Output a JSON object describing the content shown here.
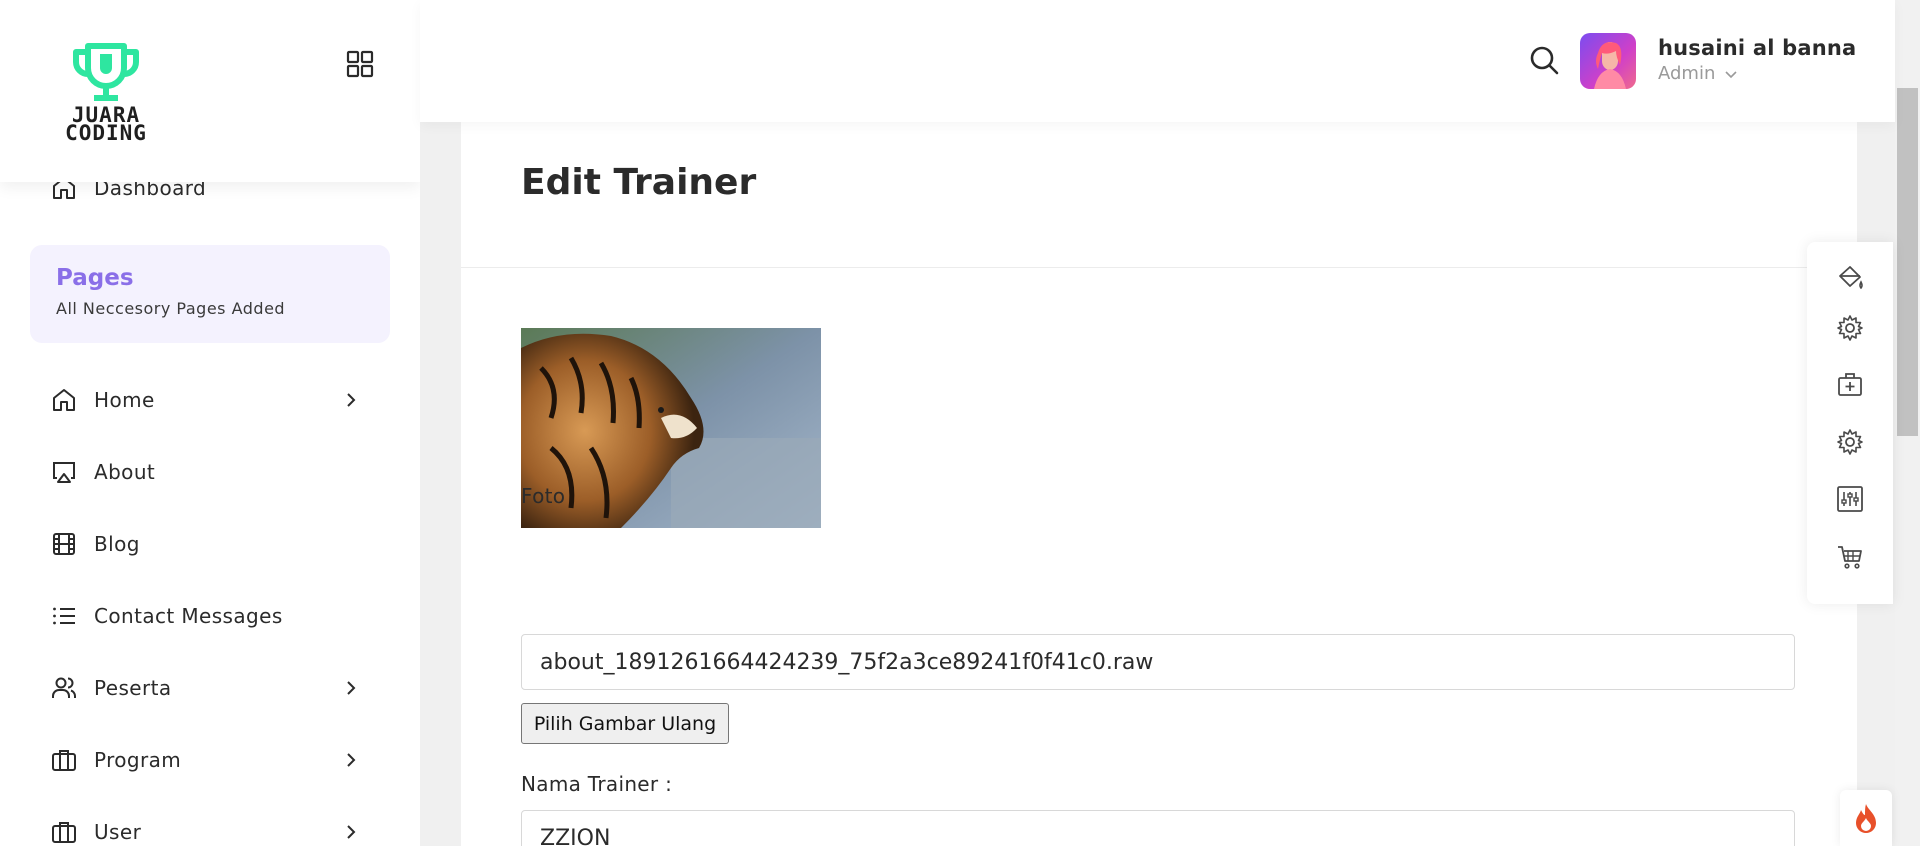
{
  "brand": {
    "logo_text_line1": "JUARA",
    "logo_text_line2": "CODING"
  },
  "sidebar": {
    "dashboard_label": "Dashboard",
    "pages_card": {
      "title": "Pages",
      "subtitle": "All Neccesory Pages Added"
    },
    "items": [
      {
        "label": "Home",
        "icon": "home-icon",
        "has_submenu": true
      },
      {
        "label": "About",
        "icon": "airplay-icon",
        "has_submenu": false
      },
      {
        "label": "Blog",
        "icon": "film-icon",
        "has_submenu": false
      },
      {
        "label": "Contact Messages",
        "icon": "list-icon",
        "has_submenu": false
      },
      {
        "label": "Peserta",
        "icon": "users-icon",
        "has_submenu": true
      },
      {
        "label": "Program",
        "icon": "briefcase-icon",
        "has_submenu": true
      },
      {
        "label": "User",
        "icon": "briefcase-icon",
        "has_submenu": true
      }
    ]
  },
  "header": {
    "user_name": "husaini al banna",
    "user_role": "Admin"
  },
  "main": {
    "title": "Edit Trainer",
    "foto_label": "Foto",
    "foto_value": "about_1891261664424239_75f2a3ce89241f0f41c0.raw",
    "reselect_button": "Pilih Gambar Ulang",
    "nama_label": "Nama Trainer :",
    "nama_value": "ZZION"
  },
  "float_panel": {
    "icons": [
      "paint-bucket-icon",
      "gear-icon",
      "medical-box-icon",
      "gear-icon",
      "sliders-icon",
      "cart-icon"
    ]
  },
  "colors": {
    "accent": "#8a6fe8",
    "logo_green": "#2ee6a0",
    "pages_bg": "#f4f2fe",
    "fire": "#e8502a"
  }
}
